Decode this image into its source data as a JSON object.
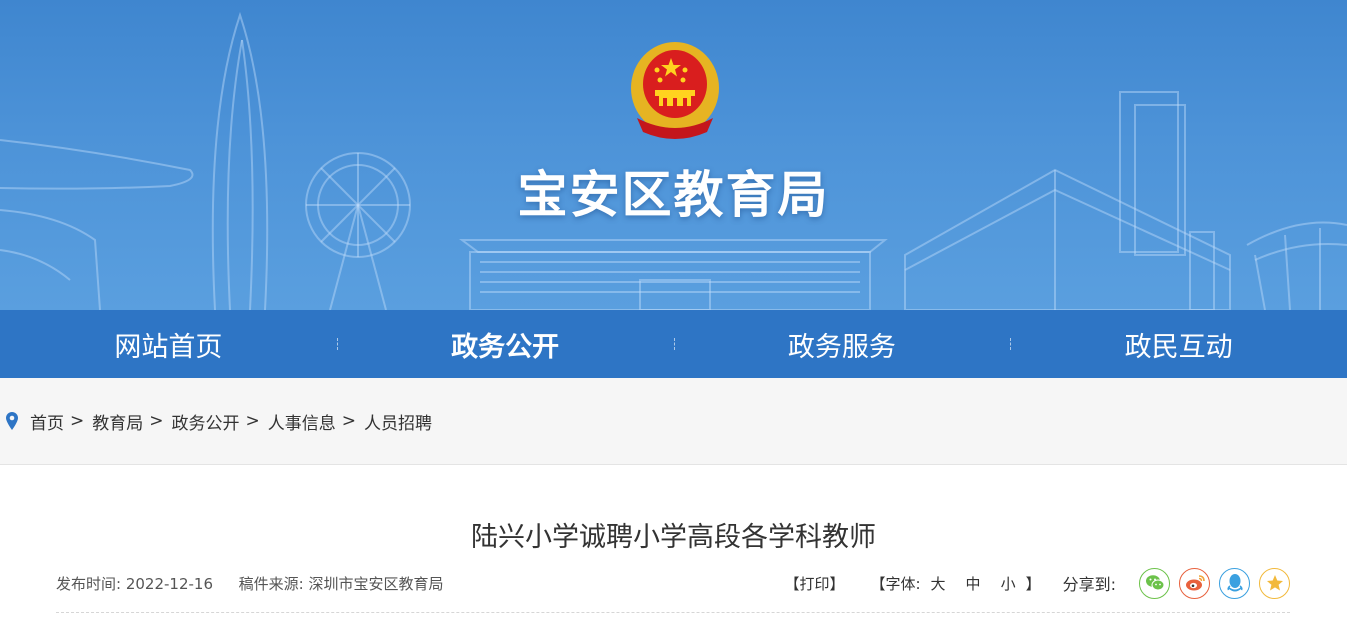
{
  "site": {
    "title": "宝安区教育局"
  },
  "nav": [
    {
      "label": "网站首页",
      "active": false
    },
    {
      "label": "政务公开",
      "active": true
    },
    {
      "label": "政务服务",
      "active": false
    },
    {
      "label": "政民互动",
      "active": false
    }
  ],
  "breadcrumb": {
    "items": [
      "首页",
      "教育局",
      "政务公开",
      "人事信息",
      "人员招聘"
    ],
    "separator": ">"
  },
  "article": {
    "title": "陆兴小学诚聘小学高段各学科教师",
    "publish_label": "发布时间:",
    "publish_date": "2022-12-16",
    "source_label": "稿件来源:",
    "source": "深圳市宝安区教育局"
  },
  "tools": {
    "print": "【打印】",
    "font_open": "【字体:",
    "font_large": "大",
    "font_medium": "中",
    "font_small": "小",
    "font_close": "】",
    "share_label": "分享到:"
  },
  "icons": [
    "location-pin-icon",
    "national-emblem",
    "wechat-icon",
    "weibo-icon",
    "qq-icon",
    "favorite-star-icon"
  ],
  "colors": {
    "banner": "#4d93d8",
    "nav": "#2e75c5",
    "breadcrumb_bg": "#f6f6f6",
    "wechat": "#6cc24a",
    "weibo": "#e8613d",
    "qq": "#3aa0e0",
    "favorite": "#f2b93b"
  }
}
